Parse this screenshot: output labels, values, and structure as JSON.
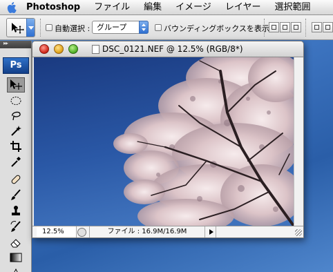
{
  "menubar": {
    "app_name": "Photoshop",
    "items": [
      "ファイル",
      "編集",
      "イメージ",
      "レイヤー",
      "選択範囲"
    ]
  },
  "options_bar": {
    "auto_select_label": "自動選択 :",
    "auto_select_checked": false,
    "auto_select_target": "グループ",
    "bounding_box_label": "バウンディングボックスを表示",
    "bounding_box_checked": false
  },
  "tools_panel": {
    "logo_text": "Ps",
    "tools": [
      "move-tool",
      "elliptical-marquee-tool",
      "lasso-tool",
      "magic-wand-tool",
      "crop-tool",
      "eyedropper-tool",
      "healing-brush-tool",
      "brush-tool",
      "clone-stamp-tool",
      "history-brush-tool",
      "eraser-tool",
      "gradient-tool",
      "blur-tool"
    ],
    "active_tool": "move-tool"
  },
  "document": {
    "title": "DSC_0121.NEF @ 12.5% (RGB/8*)",
    "zoom": "12.5%",
    "status_text": "ファイル : 16.9M/16.9M"
  },
  "colors": {
    "sky_blue": "#24519e",
    "blossom": "#e8d6d8",
    "accent": "#2f6fd0"
  }
}
